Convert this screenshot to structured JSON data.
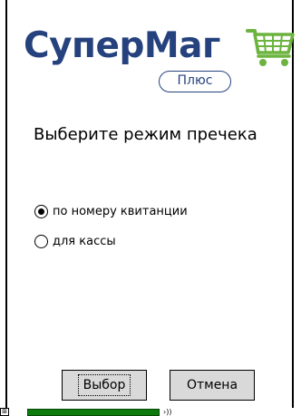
{
  "logo": {
    "brand_part1": "Супер",
    "brand_part2": "Маг",
    "badge": "Плюс",
    "colors": {
      "brand_blue": "#25427e",
      "cart_green": "#6cb33f"
    }
  },
  "dialog": {
    "heading": "Выберите режим пречека",
    "options": [
      {
        "label": "по номеру квитанции",
        "selected": true
      },
      {
        "label": "для кассы",
        "selected": false
      }
    ],
    "buttons": {
      "select_label": "Выбор",
      "cancel_label": "Отмена"
    }
  },
  "taskbar": {
    "icons": [
      "start-icon",
      "progress-bar",
      "signal-icon"
    ]
  }
}
